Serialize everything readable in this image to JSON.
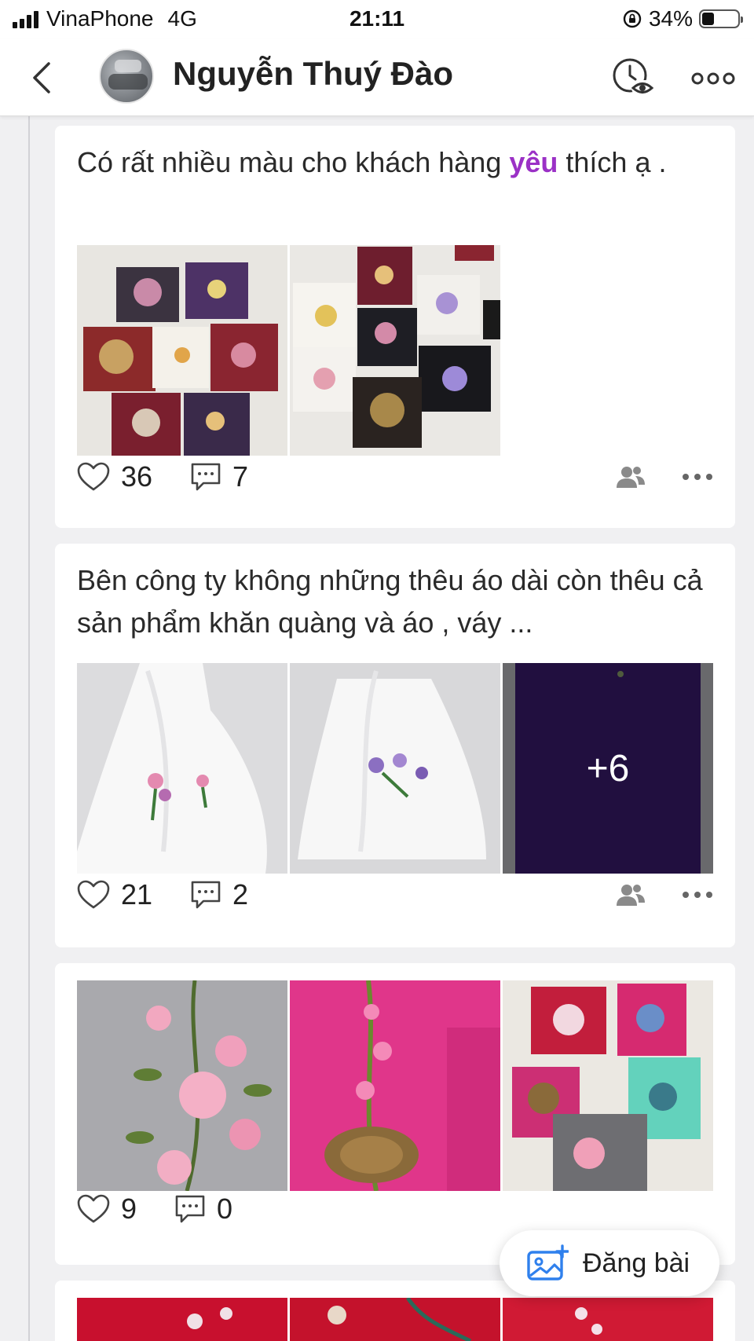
{
  "status_bar": {
    "carrier": "VinaPhone",
    "network": "4G",
    "time": "21:11",
    "battery": "34%",
    "battery_level": 0.34
  },
  "header": {
    "title": "Nguyễn Thuý Đào",
    "back_icon": "chevron-left-icon",
    "history_icon": "clock-eye-icon",
    "more_icon": "more-horizontal-icon"
  },
  "posts": [
    {
      "text_before": "Có rất nhiều màu cho khách hàng ",
      "text_highlight": "yêu",
      "text_after": " thích ạ .",
      "likes": "36",
      "comments": "7",
      "photos": [
        "embroidered-fabrics-assorted",
        "embroidered-fabrics-assorted-2"
      ]
    },
    {
      "text": "Bên công ty không những thêu áo dài còn thêu cả sản phẩm khăn quàng và áo , váy ...",
      "likes": "21",
      "comments": "2",
      "photos": [
        "white-scarf-embroidered",
        "white-scarf-embroidered-2",
        "purple-fabric"
      ],
      "more_count": "+6"
    },
    {
      "likes": "9",
      "comments": "0",
      "photos": [
        "grey-fabric-roses",
        "pink-fabric-orchids",
        "folded-fabrics-assorted"
      ]
    }
  ],
  "fab": {
    "label": "Đăng bài",
    "icon": "add-photo-icon"
  },
  "colors": {
    "highlight": "#9b31c6",
    "fab_icon": "#2f80ed",
    "icon_grey": "#8a8a8a"
  }
}
